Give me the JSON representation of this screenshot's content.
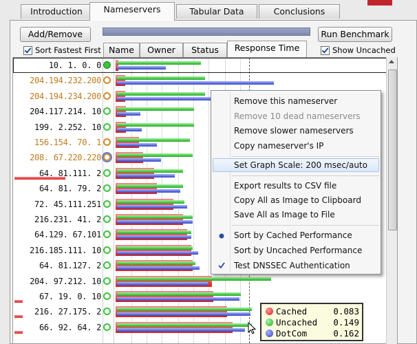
{
  "tabs": [
    "Introduction",
    "Nameservers",
    "Tabular Data",
    "Conclusions"
  ],
  "active_tab": "Nameservers",
  "toolbar": {
    "add_remove": "Add/Remove",
    "run_benchmark": "Run Benchmark",
    "sort_fastest_first": "Sort Fastest First",
    "show_uncached": "Show Uncached"
  },
  "columns": [
    "Name",
    "Owner",
    "Status",
    "Response Time"
  ],
  "selected_column": "Response Time",
  "rows": [
    {
      "ip": "10.  1.  0.  0",
      "color": "#111111",
      "status": "green-filled",
      "red": 4,
      "green": 122,
      "blue": 71
    },
    {
      "ip": "204.194.232.200",
      "color": "#c07a1c",
      "status": "orange",
      "red": 14,
      "green": 128,
      "blue": 228
    },
    {
      "ip": "204.194.234.200",
      "color": "#c07a1c",
      "status": "orange",
      "red": 14,
      "green": 128,
      "blue": 204
    },
    {
      "ip": "204.117.214. 10",
      "color": "#111111",
      "status": "green",
      "red": 15,
      "green": 112,
      "blue": 34
    },
    {
      "ip": "199.  2.252. 10",
      "color": "#111111",
      "status": "green",
      "red": 15,
      "green": 112,
      "blue": 36
    },
    {
      "ip": "156.154. 70.  1",
      "color": "#c07a1c",
      "status": "orange",
      "red": 34,
      "green": 106,
      "blue": 58
    },
    {
      "ip": "208. 67.220.220",
      "color": "#c07a1c",
      "status": "blue-selected",
      "red": 40,
      "green": 110,
      "blue": 64
    },
    {
      "ip": "64. 81.111.  2",
      "color": "#111111",
      "status": "green",
      "red": 56,
      "green": 96,
      "blue": 84
    },
    {
      "ip": "64. 81. 79.  2",
      "color": "#111111",
      "status": "green",
      "red": 60,
      "green": 96,
      "blue": 92
    },
    {
      "ip": "72. 45.111.251",
      "color": "#111111",
      "status": "green",
      "red": 84,
      "green": 98,
      "blue": 102
    },
    {
      "ip": "216.231. 41.  2",
      "color": "#111111",
      "status": "green",
      "red": 98,
      "green": 110,
      "blue": 110
    },
    {
      "ip": "64.129. 67.101",
      "color": "#111111",
      "status": "green",
      "red": 104,
      "green": 108,
      "blue": 108
    },
    {
      "ip": "216.185.111. 10",
      "color": "#111111",
      "status": "green",
      "red": 110,
      "green": 110,
      "blue": 118
    },
    {
      "ip": "64. 81.127.  2",
      "color": "#111111",
      "status": "green",
      "red": 112,
      "green": 114,
      "blue": 120
    },
    {
      "ip": "204. 97.212. 10",
      "color": "#111111",
      "status": "green",
      "red": 140,
      "green": 224,
      "blue": 132
    },
    {
      "ip": "67. 19.  0. 10",
      "color": "#111111",
      "status": "green",
      "red": 142,
      "green": 180,
      "blue": 178
    },
    {
      "ip": "216. 27.175.  2",
      "color": "#111111",
      "status": "green",
      "red": 162,
      "green": 196,
      "blue": 194
    },
    {
      "ip": "66. 92. 64.  2",
      "color": "#111111",
      "status": "green",
      "red": 170,
      "green": 196,
      "blue": 186
    }
  ],
  "context_menu": {
    "items": [
      {
        "label": "Remove this nameserver",
        "enabled": true,
        "mark": ""
      },
      {
        "label": "Remove 10 dead nameservers",
        "enabled": false,
        "mark": ""
      },
      {
        "label": "Remove slower nameservers",
        "enabled": true,
        "mark": ""
      },
      {
        "label": "Copy nameserver's IP",
        "enabled": true,
        "mark": ""
      },
      {
        "label": "Set Graph Scale: 200 msec/auto",
        "enabled": true,
        "mark": "",
        "highlighted": true
      },
      {
        "label": "Export results to CSV file",
        "enabled": true,
        "mark": ""
      },
      {
        "label": "Copy All as Image to Clipboard",
        "enabled": true,
        "mark": ""
      },
      {
        "label": "Save All as Image to File",
        "enabled": true,
        "mark": ""
      },
      {
        "label": "Sort by Cached Performance",
        "enabled": true,
        "mark": "radio"
      },
      {
        "label": "Sort by Uncached Performance",
        "enabled": true,
        "mark": ""
      },
      {
        "label": "Test DNSSEC Authentication",
        "enabled": true,
        "mark": "check"
      }
    ]
  },
  "tooltip": {
    "rows": [
      {
        "label": "Cached",
        "value": "0.083",
        "color": "#d81e1e"
      },
      {
        "label": "Uncached",
        "value": "0.149",
        "color": "#1ea91e"
      },
      {
        "label": "DotCom",
        "value": "0.162",
        "color": "#3243c8"
      }
    ]
  },
  "colors": {
    "red": "#d81e1e",
    "green": "#1ea91e",
    "blue": "#3243c8",
    "orange": "#d08a2a"
  }
}
